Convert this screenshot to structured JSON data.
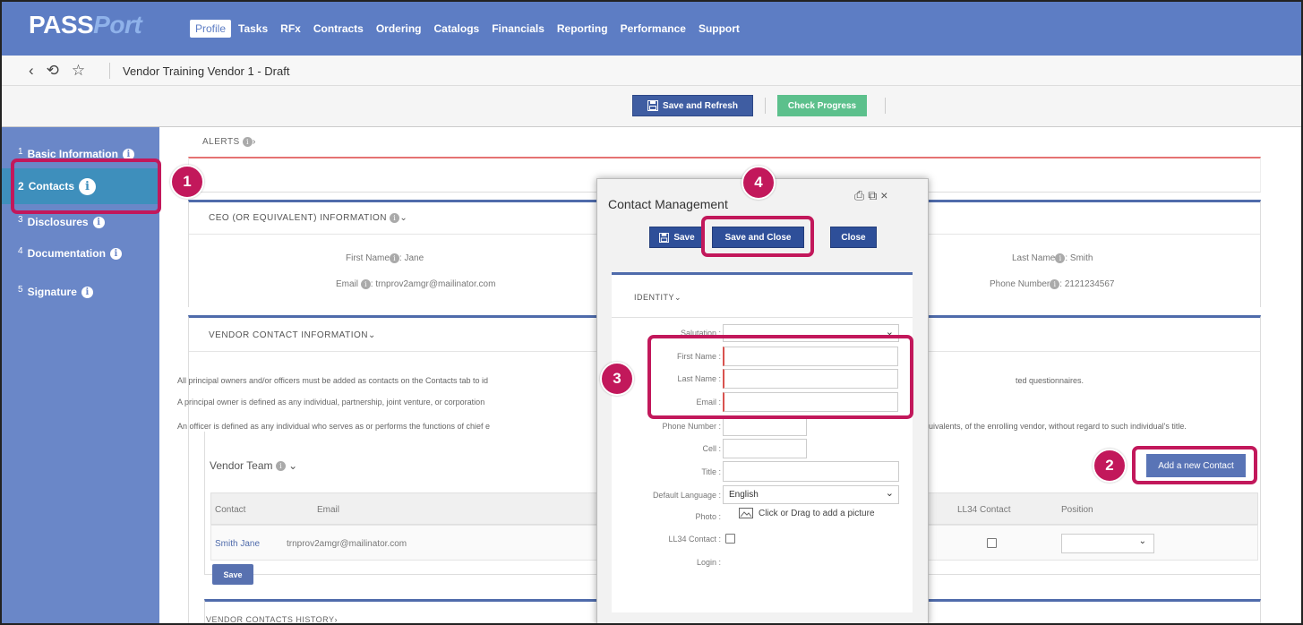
{
  "header": {
    "logo_main": "PASS",
    "logo_accent": "Port",
    "nav": [
      "Profile",
      "Tasks",
      "RFx",
      "Contracts",
      "Ordering",
      "Catalogs",
      "Financials",
      "Reporting",
      "Performance",
      "Support"
    ]
  },
  "breadcrumb": {
    "back_icon": "‹",
    "history_icon": "⟲",
    "star_icon": "☆",
    "title": "Vendor Training Vendor 1 - Draft"
  },
  "actions": {
    "save_refresh": "Save and Refresh",
    "check_progress": "Check Progress"
  },
  "sidebar": {
    "items": [
      {
        "num": "1",
        "label": "Basic Information"
      },
      {
        "num": "2",
        "label": "Contacts"
      },
      {
        "num": "3",
        "label": "Disclosures"
      },
      {
        "num": "4",
        "label": "Documentation"
      },
      {
        "num": "5",
        "label": "Signature"
      }
    ]
  },
  "main": {
    "alerts_label": "ALERTS",
    "ceo": {
      "header": "CEO (OR EQUIVALENT) INFORMATION",
      "first_name_label": "First Name",
      "first_name_value": ": Jane",
      "last_name_label": "Last Name",
      "last_name_value": ": Smith",
      "email_label": "Email",
      "email_value": ": trnprov2amgr@mailinator.com",
      "phone_label": "Phone Number",
      "phone_value": ": 2121234567"
    },
    "vendor_contact": {
      "header": "VENDOR CONTACT INFORMATION",
      "para1_left": "All principal owners and/or officers must be added as contacts on the Contacts tab to id",
      "para1_right": "ted questionnaires.",
      "para2_left": "A principal owner is defined as any individual, partnership, joint venture, or corporation",
      "para3_left": "An officer is defined as any individual who serves as or performs the functions of chief e",
      "para3_right": "quivalents, of the enrolling vendor, without regard to such individual's title."
    },
    "team": {
      "title": "Vendor Team",
      "add_button": "Add a new Contact",
      "columns": {
        "contact": "Contact",
        "email": "Email",
        "ll34": "LL34 Contact",
        "position": "Position"
      },
      "rows": [
        {
          "contact": "Smith Jane",
          "email": "trnprov2amgr@mailinator.com"
        }
      ],
      "save_button": "Save"
    },
    "history_label": "VENDOR CONTACTS HISTORY"
  },
  "modal": {
    "title": "Contact Management",
    "icons": {
      "print": "⎙",
      "restore": "⧉",
      "close": "×"
    },
    "buttons": {
      "save": "Save",
      "save_close": "Save and Close",
      "close": "Close"
    },
    "section": "IDENTITY",
    "fields": {
      "salutation": "Salutation :",
      "first_name": "First Name :",
      "last_name": "Last Name :",
      "email": "Email :",
      "phone": "Phone Number :",
      "cell": "Cell :",
      "title": "Title :",
      "language": "Default Language :",
      "language_value": "English",
      "photo": "Photo :",
      "photo_hint": "Click or Drag to add a picture",
      "ll34": "LL34 Contact :",
      "login": "Login :"
    }
  },
  "callouts": [
    "1",
    "2",
    "3",
    "4"
  ],
  "colors": {
    "header": "#5d7dc4",
    "sidebar": "#6a87c8",
    "highlight": "#c2185b",
    "primary_btn": "#2e4f99",
    "green_btn": "#5cc08c"
  }
}
